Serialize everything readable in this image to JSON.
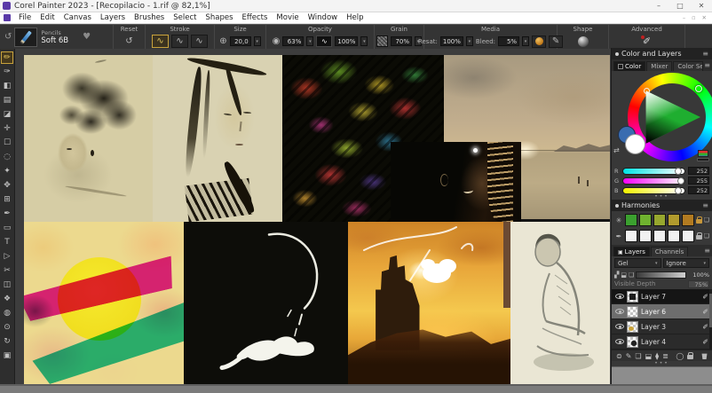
{
  "window": {
    "title": "Corel Painter 2023 - [Recopilacio - 1.rif @ 82,1%]",
    "controls": {
      "minimize": "–",
      "maximize": "□",
      "close": "✕"
    },
    "child_controls": {
      "minimize": "–",
      "restore": "▫",
      "close": "✕"
    }
  },
  "menu": {
    "items": [
      "File",
      "Edit",
      "Canvas",
      "Layers",
      "Brushes",
      "Select",
      "Shapes",
      "Effects",
      "Movie",
      "Window",
      "Help"
    ]
  },
  "icons": {
    "history": "↺",
    "heart": "♥",
    "reset_brush": "↺",
    "stroke_a": "∿",
    "stroke_b": "∿",
    "stroke_c": "∿",
    "size": "⊕",
    "opacity": "◉",
    "expression": "∿",
    "pen": "✎",
    "advanced_brush": "✐",
    "hamburger": "≡",
    "caret": "▾",
    "dots": "•••",
    "swap": "⇄",
    "harmony_row1": "✳",
    "harmony_row2": "✒",
    "lock_pick": "▞",
    "preserve": "⬓",
    "pickup": "❏",
    "ltb_1": "⊜",
    "ltb_2": "✎",
    "ltb_3": "❏",
    "ltb_4": "⬓",
    "ltb_5": "⧫",
    "ltb_6": "≣",
    "ltb_mask": "◯",
    "layer_badge": "✐",
    "layers_tab_icon": "▣"
  },
  "propertybar": {
    "brush_selector": {
      "category": "Pencils",
      "variant": "Soft 6B"
    },
    "reset": {
      "label": "Reset"
    },
    "stroke": {
      "label": "Stroke"
    },
    "size": {
      "label": "Size",
      "value": "20,0"
    },
    "opacity": {
      "label": "Opacity",
      "value": "63%",
      "expression_value": "100%"
    },
    "grain": {
      "label": "Grain",
      "value": "70%"
    },
    "media": {
      "label": "Media",
      "resat_label": "Resat:",
      "resat_value": "100%",
      "bleed_label": "Bleed:",
      "bleed_value": "5%"
    },
    "shape": {
      "label": "Shape"
    },
    "advanced": {
      "label": "Advanced"
    }
  },
  "toolbox": {
    "tools": [
      {
        "name": "brush-tool",
        "glyph": "✏"
      },
      {
        "name": "dropper-tool",
        "glyph": "✑"
      },
      {
        "name": "paint-bucket-tool",
        "glyph": "◧"
      },
      {
        "name": "paper-selector",
        "glyph": "▤"
      },
      {
        "name": "eraser-tool",
        "glyph": "◪"
      },
      {
        "name": "layer-adjuster-tool",
        "glyph": "✛"
      },
      {
        "name": "rect-select-tool",
        "glyph": "☐"
      },
      {
        "name": "lasso-tool",
        "glyph": "◌"
      },
      {
        "name": "magic-wand-tool",
        "glyph": "✦"
      },
      {
        "name": "transform-tool",
        "glyph": "✥"
      },
      {
        "name": "crop-tool",
        "glyph": "⊞"
      },
      {
        "name": "pen-tool",
        "glyph": "✒"
      },
      {
        "name": "rect-shape-tool",
        "glyph": "▭"
      },
      {
        "name": "text-tool",
        "glyph": "T"
      },
      {
        "name": "shape-select-tool",
        "glyph": "▷"
      },
      {
        "name": "scissors-tool",
        "glyph": "✂"
      },
      {
        "name": "mirror-painting-tool",
        "glyph": "◫"
      },
      {
        "name": "kaleidoscope-tool",
        "glyph": "❖"
      },
      {
        "name": "cloner-tool",
        "glyph": "◍"
      },
      {
        "name": "magnifier-tool",
        "glyph": "⊙"
      },
      {
        "name": "rotate-page-tool",
        "glyph": "↻"
      },
      {
        "name": "navigator-toggle",
        "glyph": "▣"
      }
    ]
  },
  "color_panel": {
    "header": "Color and Layers",
    "tabs": [
      {
        "label": "Color"
      },
      {
        "label": "Mixer"
      },
      {
        "label": "Color Set Librarie"
      }
    ],
    "rgb_sliders": [
      {
        "label": "R",
        "value": "252"
      },
      {
        "label": "G",
        "value": "255"
      },
      {
        "label": "B",
        "value": "252"
      }
    ],
    "primary_color": "#ffffff",
    "secondary_color": "#3a6cb0"
  },
  "harmonies": {
    "header": "Harmonies",
    "row1": [
      "#3ba02f",
      "#6fb22f",
      "#97a72e",
      "#b19b2d",
      "#b27b21"
    ],
    "row2": [
      "#f2f2f2",
      "#f2f2f2",
      "#f2f2f2",
      "#f2f2f2",
      "#f2f2f2"
    ]
  },
  "layers_panel": {
    "tabs": [
      {
        "label": "Layers"
      },
      {
        "label": "Channels"
      }
    ],
    "composite_method": "Gel",
    "composite_depth": "Ignore",
    "opacity_value": "100%",
    "visible_depth_label": "Visible Depth",
    "visible_depth_value": "75%",
    "layers": [
      {
        "name": "Layer 7"
      },
      {
        "name": "Layer 6"
      },
      {
        "name": "Layer 3"
      },
      {
        "name": "Layer 4"
      }
    ]
  },
  "canvas": {
    "tiles": [
      "curly-hair-sketch",
      "woman-portrait-sketch",
      "nebula-abstract",
      "misty-seascape",
      "child-face-painting",
      "geometric-abstract",
      "black-line-art",
      "sunset-castle",
      "figure-pencil-sketch"
    ]
  }
}
